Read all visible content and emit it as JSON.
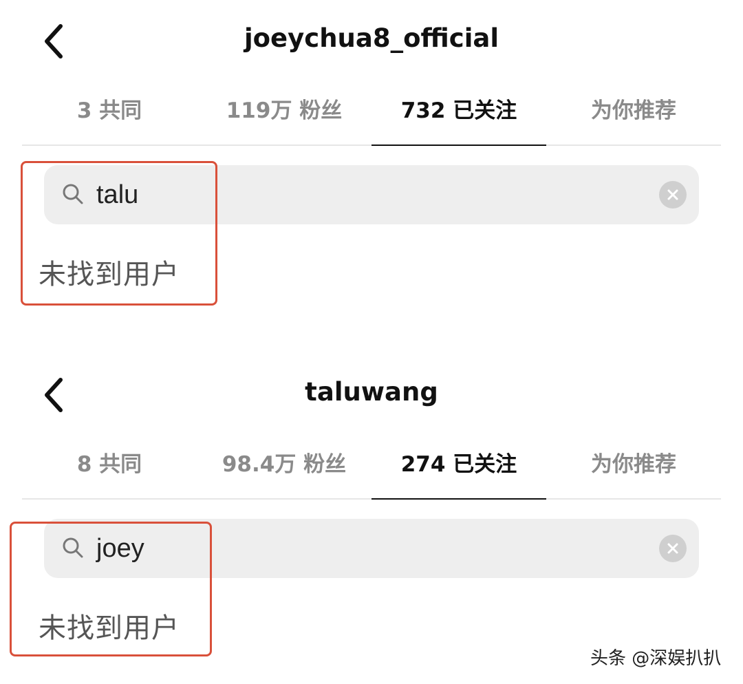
{
  "screens": [
    {
      "username": "joeychua8_official",
      "tabs": [
        {
          "label": "3 共同"
        },
        {
          "label": "119万 粉丝"
        },
        {
          "label": "732 已关注"
        },
        {
          "label": "为你推荐"
        }
      ],
      "active_tab": 2,
      "search": {
        "value": "talu"
      },
      "empty_text": "未找到用户"
    },
    {
      "username": "taluwang",
      "tabs": [
        {
          "label": "8 共同"
        },
        {
          "label": "98.4万 粉丝"
        },
        {
          "label": "274 已关注"
        },
        {
          "label": "为你推荐"
        }
      ],
      "active_tab": 2,
      "search": {
        "value": "joey"
      },
      "empty_text": "未找到用户"
    }
  ],
  "watermark": "头条 @深娱扒扒",
  "colors": {
    "highlight": "#d9503a",
    "search_bg": "#eeeeee",
    "inactive_tab": "#8a8a8a"
  },
  "icons": [
    "back-arrow-icon",
    "search-icon",
    "clear-icon"
  ]
}
